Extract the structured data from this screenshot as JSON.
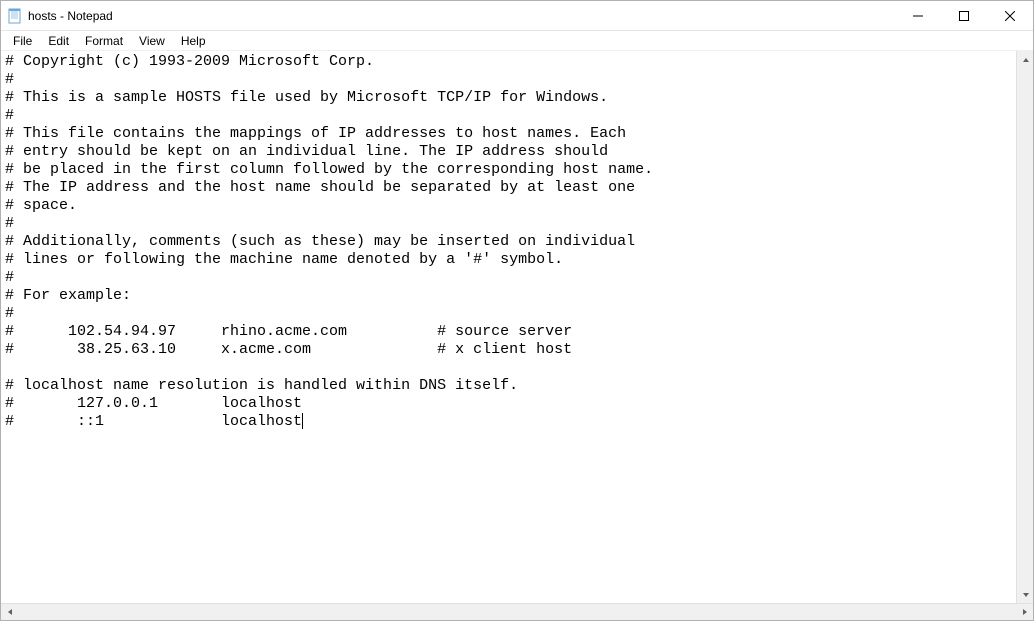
{
  "window": {
    "title": "hosts - Notepad"
  },
  "menu": {
    "file": "File",
    "edit": "Edit",
    "format": "Format",
    "view": "View",
    "help": "Help"
  },
  "content": {
    "text": "# Copyright (c) 1993-2009 Microsoft Corp.\n#\n# This is a sample HOSTS file used by Microsoft TCP/IP for Windows.\n#\n# This file contains the mappings of IP addresses to host names. Each\n# entry should be kept on an individual line. The IP address should\n# be placed in the first column followed by the corresponding host name.\n# The IP address and the host name should be separated by at least one\n# space.\n#\n# Additionally, comments (such as these) may be inserted on individual\n# lines or following the machine name denoted by a '#' symbol.\n#\n# For example:\n#\n#      102.54.94.97     rhino.acme.com          # source server\n#       38.25.63.10     x.acme.com              # x client host\n\n# localhost name resolution is handled within DNS itself.\n#       127.0.0.1       localhost\n#       ::1             localhost"
  }
}
